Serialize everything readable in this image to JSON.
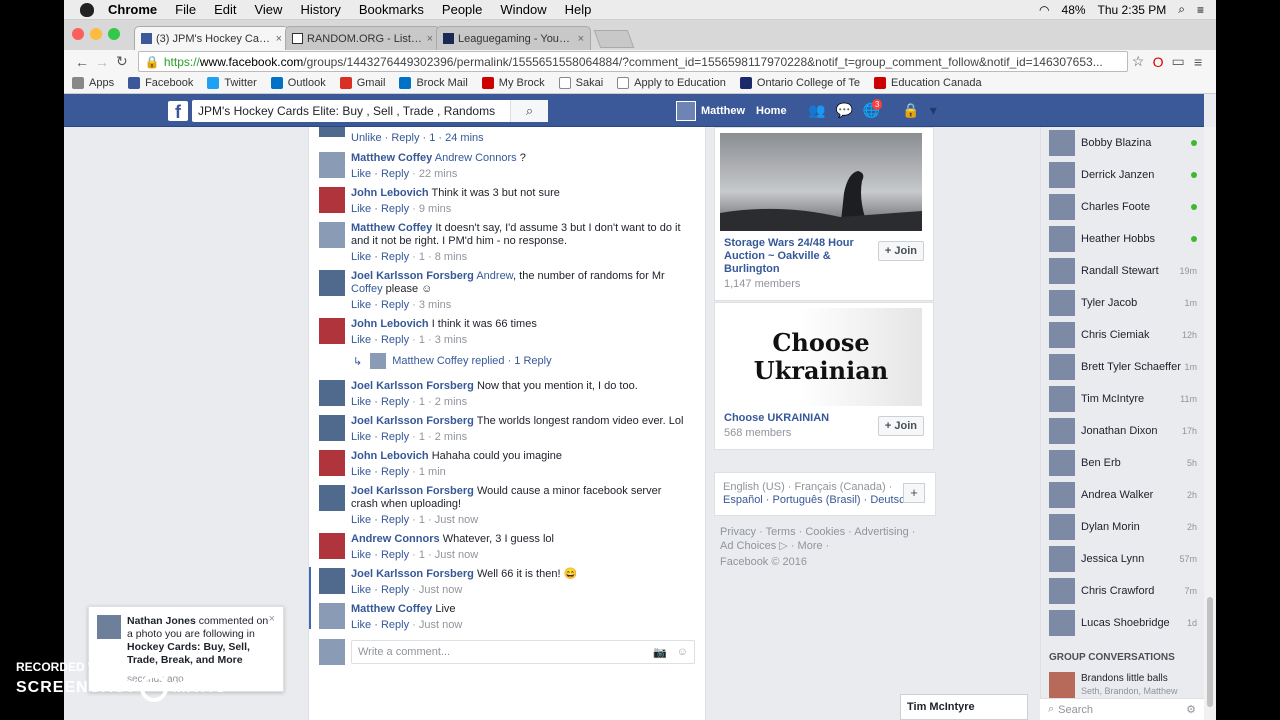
{
  "menubar": {
    "app": "Chrome",
    "items": [
      "File",
      "Edit",
      "View",
      "History",
      "Bookmarks",
      "People",
      "Window",
      "Help"
    ],
    "battery": "48%",
    "clock": "Thu 2:35 PM"
  },
  "tabs": [
    {
      "title": "(3) JPM's Hockey Cards Eli",
      "active": true
    },
    {
      "title": "RANDOM.ORG - List Rand",
      "active": false
    },
    {
      "title": "Leaguegaming - Your Virtu",
      "active": false
    }
  ],
  "url": {
    "scheme": "https://",
    "host": "www.facebook.com",
    "path": "/groups/1443276449302396/permalink/1555651558064884/?comment_id=1556598117970228&notif_t=group_comment_follow&notif_id=146307653..."
  },
  "bookmarks": [
    "Apps",
    "Facebook",
    "Twitter",
    "Outlook",
    "Gmail",
    "Brock Mail",
    "My Brock",
    "Sakai",
    "Apply to Education",
    "Ontario College of Te",
    "Education Canada"
  ],
  "fb": {
    "search": "JPM's Hockey Cards Elite: Buy , Sell , Trade , Randoms",
    "user": "Matthew",
    "home": "Home",
    "notif_count": "3"
  },
  "comments": [
    {
      "name": "",
      "text": "",
      "meta": "Unlike · Reply · 1 · 24 mins"
    },
    {
      "name": "Matthew Coffey",
      "link": "Andrew Connors",
      "text": " ?",
      "meta_a": "Like · Reply",
      "meta": " · 22 mins"
    },
    {
      "name": "John Lebovich",
      "text": "Think it was 3 but not sure",
      "meta_a": "Like · Reply",
      "meta": " · 9 mins"
    },
    {
      "name": "Matthew Coffey",
      "text": "It doesn't say, I'd assume 3 but I don't want to do it and it not be right. I PM'd him - no response.",
      "meta_a": "Like · Reply",
      "meta": " · 1 · 8 mins"
    },
    {
      "name": "Joel Karlsson Forsberg",
      "link": "Andrew",
      "text": ", the number of randoms for Mr ",
      "link2": "Coffey",
      "text2": " please ☺",
      "meta_a": "Like · Reply",
      "meta": " · 3 mins"
    },
    {
      "name": "John Lebovich",
      "text": "I think it was 66 times",
      "meta_a": "Like · Reply",
      "meta": " · 1 · 3 mins"
    },
    {
      "name": "Joel Karlsson Forsberg",
      "text": "Now that you mention it, I do too.",
      "meta_a": "Like · Reply",
      "meta": " · 1 · 2 mins"
    },
    {
      "name": "Joel Karlsson Forsberg",
      "text": "The worlds longest random video ever. Lol",
      "meta_a": "Like · Reply",
      "meta": " · 1 · 2 mins"
    },
    {
      "name": "John Lebovich",
      "text": "Hahaha could you imagine",
      "meta_a": "Like · Reply",
      "meta": " · 1 min"
    },
    {
      "name": "Joel Karlsson Forsberg",
      "text": "Would cause a minor facebook server crash when uploading!",
      "meta_a": "Like · Reply",
      "meta": " · 1 · Just now"
    },
    {
      "name": "Andrew Connors",
      "text": "Whatever, 3 I guess lol",
      "meta_a": "Like · Reply",
      "meta": " · 1 · Just now"
    },
    {
      "name": "Joel Karlsson Forsberg",
      "text": "Well 66 it is then! 😄",
      "meta_a": "Like · Reply",
      "meta": " · Just now"
    },
    {
      "name": "Matthew Coffey",
      "text": "Live",
      "meta_a": "Like · Reply",
      "meta": " · Just now"
    }
  ],
  "reply_line": "Matthew Coffey replied · 1 Reply",
  "write_placeholder": "Write a comment...",
  "groups": [
    {
      "name": "Storage Wars 24/48 Hour Auction ~ Oakville & Burlington",
      "members": "1,147 members",
      "join": "+ Join"
    },
    {
      "name": "Choose UKRAINIAN",
      "members": "568 members",
      "join": "+ Join",
      "banner": "Choose Ukrainian"
    }
  ],
  "languages": {
    "line1": "English (US) · Français (Canada) ·",
    "line2": "Español · Português (Brasil) · Deutsch"
  },
  "footer": {
    "line1": "Privacy · Terms · Cookies · Advertising ·",
    "line2": "Ad Choices ▷ · More ·",
    "line3": "Facebook © 2016"
  },
  "chat": [
    {
      "name": "Bobby Blazina",
      "status": "online"
    },
    {
      "name": "Derrick Janzen",
      "status": "online"
    },
    {
      "name": "Charles Foote",
      "status": "online"
    },
    {
      "name": "Heather Hobbs",
      "status": "online"
    },
    {
      "name": "Randall Stewart",
      "status": "19m"
    },
    {
      "name": "Tyler Jacob",
      "status": "1m"
    },
    {
      "name": "Chris Ciemiak",
      "status": "12h"
    },
    {
      "name": "Brett Tyler Schaeffer",
      "status": "1m"
    },
    {
      "name": "Tim McIntyre",
      "status": "11m"
    },
    {
      "name": "Jonathan Dixon",
      "status": "17h"
    },
    {
      "name": "Ben Erb",
      "status": "5h"
    },
    {
      "name": "Andrea Walker",
      "status": "2h"
    },
    {
      "name": "Dylan Morin",
      "status": "2h"
    },
    {
      "name": "Jessica Lynn",
      "status": "57m"
    },
    {
      "name": "Chris Crawford",
      "status": "7m"
    },
    {
      "name": "Lucas Shoebridge",
      "status": "1d"
    }
  ],
  "group_conversations": {
    "title": "GROUP CONVERSATIONS",
    "name": "Brandons little balls",
    "members": "Seth, Brandon, Matthew"
  },
  "chat_search": "Search",
  "chat_tab": "Tim McIntyre",
  "notification": {
    "name": "Nathan Jones",
    "text": " commented on a photo you are following in ",
    "group": "Hockey Cards: Buy, Sell, Trade, Break, and More",
    "time": "seconds ago"
  },
  "watermark": {
    "line1": "RECORDED WITH",
    "line2a": "SCREENCAST",
    "line2b": "MATIC"
  }
}
